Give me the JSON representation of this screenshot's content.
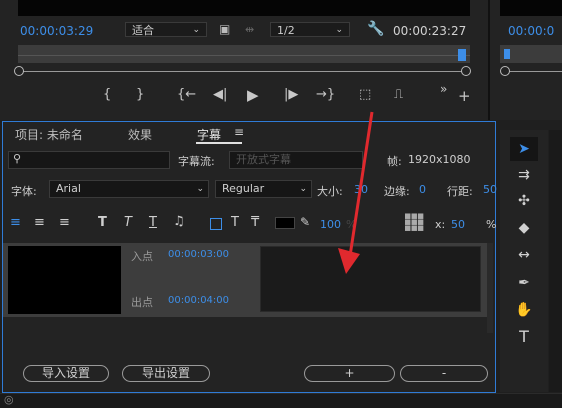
{
  "monitor": {
    "current_timecode": "00:00:03:29",
    "fit_label": "适合",
    "resolution_label": "1/2",
    "duration_timecode": "00:00:23:27",
    "controls": [
      "{",
      "}",
      "{←",
      "◀|",
      "▶",
      "|▶",
      "→}",
      "⬚",
      "⎍",
      "»",
      "+"
    ]
  },
  "right_panel": {
    "timecode": "00:00:0"
  },
  "captions": {
    "tabs": [
      "项目: 未命名",
      "效果",
      "字幕"
    ],
    "active_tab": "字幕",
    "caption_stream_label": "字幕流:",
    "caption_stream_value": "开放式字幕",
    "frame_label": "帧:",
    "frame_value": "1920x1080",
    "font_label": "字体:",
    "font_value": "Arial",
    "style_value": "Regular",
    "size_label": "大小:",
    "size_value": "30",
    "edge_label": "边缘:",
    "edge_value": "0",
    "line_spacing_label": "行距:",
    "line_spacing_value": "50",
    "opacity_value": "100",
    "opacity_suffix": "%",
    "x_label": "x:",
    "x_value": "50",
    "x_suffix": "%",
    "in_label": "入点",
    "in_time": "00:00:03:00",
    "out_label": "出点",
    "out_time": "00:00:04:00",
    "import_button": "导入设置",
    "export_button": "导出设置",
    "add_button": "+",
    "remove_button": "-"
  },
  "colors": {
    "accent": "#2f7bd6",
    "arrow": "#e0292e"
  }
}
